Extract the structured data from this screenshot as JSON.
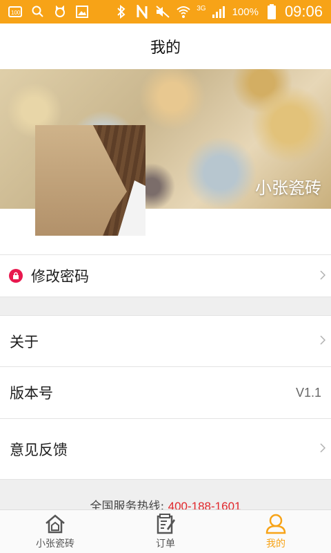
{
  "status_bar": {
    "left_icons": [
      "battery-saver-icon",
      "search-icon",
      "cat-icon",
      "image-icon"
    ],
    "network": "3G",
    "battery": "100%",
    "time": "09:06"
  },
  "header": {
    "title": "我的"
  },
  "profile": {
    "name": "小张瓷砖"
  },
  "menu": {
    "change_password": "修改密码",
    "about": "关于",
    "version_label": "版本号",
    "version_value": "V1.1",
    "feedback": "意见反馈"
  },
  "footer": {
    "hotline_label": "全国服务热线:",
    "hotline_number": "400-188-1601"
  },
  "tabs": [
    {
      "label": "小张瓷砖",
      "icon": "home-icon"
    },
    {
      "label": "订单",
      "icon": "order-icon"
    },
    {
      "label": "我的",
      "icon": "user-icon",
      "active": true
    }
  ],
  "colors": {
    "accent": "#f7a317",
    "lock": "#e8184e",
    "hotline_number": "#e1262a"
  }
}
